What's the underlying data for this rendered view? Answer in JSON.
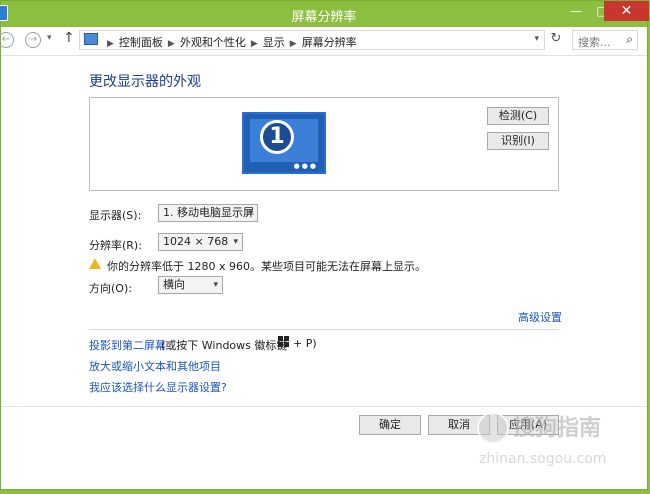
{
  "window": {
    "title": "屏幕分辨率",
    "minimize": "—",
    "maximize": "□",
    "close": "✕"
  },
  "address": {
    "breadcrumbs": [
      "控制面板",
      "外观和个性化",
      "显示",
      "屏幕分辨率"
    ],
    "search_placeholder": "搜索..."
  },
  "content": {
    "title": "更改显示器的外观",
    "monitor_number": "1",
    "detect_button": "检测(C)",
    "identify_button": "识别(I)",
    "display_label": "显示器(S):",
    "display_value": "1. 移动电脑显示屏",
    "resolution_label": "分辨率(R):",
    "resolution_value": "1024 × 768",
    "warning_text": "你的分辨率低于 1280 x 960。某些项目可能无法在屏幕上显示。",
    "orientation_label": "方向(O):",
    "orientation_value": "横向",
    "advanced_link": "高级设置",
    "project_link": "投影到第二屏幕",
    "project_suffix": "(或按下 Windows 徽标键",
    "project_plus": "+ P)",
    "zoom_link": "放大或缩小文本和其他项目",
    "help_link": "我应该选择什么显示器设置?"
  },
  "footer": {
    "ok": "确定",
    "cancel": "取消",
    "apply": "应用(A)"
  },
  "watermark": {
    "text": "搜狗指南",
    "url": "zhinan.sogou.com"
  }
}
